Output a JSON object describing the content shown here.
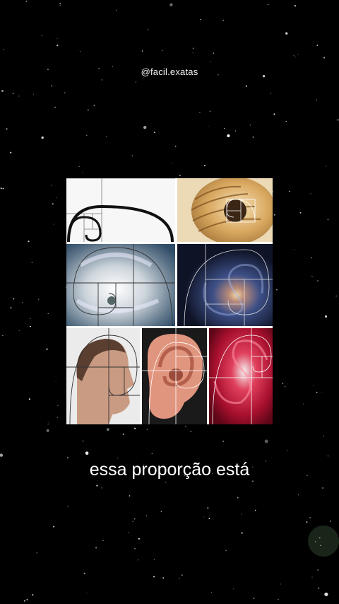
{
  "overlay": {
    "creator_handle": "@facil.exatas",
    "caption": "essa proporção está"
  },
  "collage": {
    "tiles": [
      {
        "subject": "golden-spiral-diagram"
      },
      {
        "subject": "nautilus-shell"
      },
      {
        "subject": "hurricane"
      },
      {
        "subject": "spiral-galaxy"
      },
      {
        "subject": "face-profile"
      },
      {
        "subject": "ear"
      },
      {
        "subject": "rose"
      }
    ]
  },
  "colors": {
    "background": "#000000",
    "text": "#ffffff",
    "spiral_overlay": "#e8e8e8"
  }
}
